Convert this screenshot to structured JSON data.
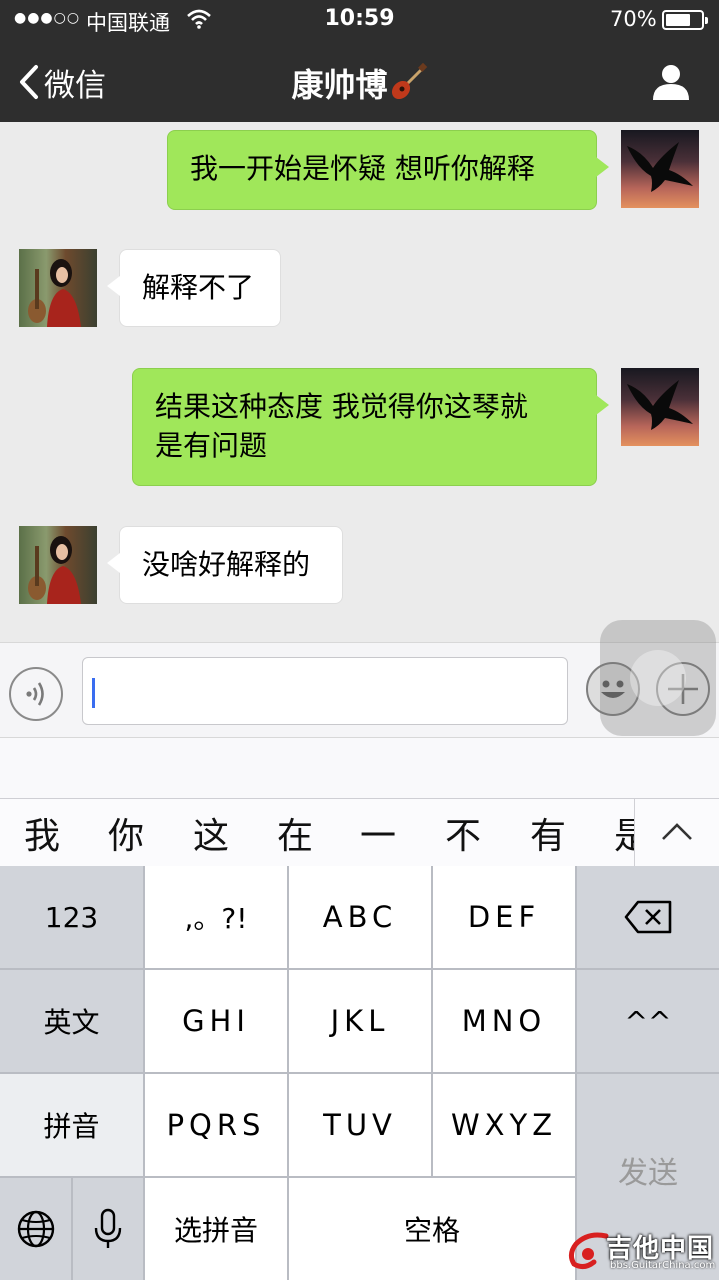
{
  "status_bar": {
    "signal": "●●●○○",
    "carrier": "中国联通",
    "time": "10:59",
    "battery_percent": "70%",
    "battery_level": 0.7
  },
  "nav": {
    "back_label": "微信",
    "title": "康帅博",
    "title_icon": "guitar-icon",
    "profile_icon": "person-icon"
  },
  "messages": [
    {
      "side": "sent",
      "text": "我一开始是怀疑 想听你解释",
      "avatar": "eagle-avatar"
    },
    {
      "side": "received",
      "text": "解释不了",
      "avatar": "girl-with-guitar-avatar"
    },
    {
      "side": "sent",
      "line1": "结果这种态度 我觉得你这琴就",
      "line2": "是有问题",
      "avatar": "eagle-avatar"
    },
    {
      "side": "received",
      "text": "没啥好解释的",
      "avatar": "girl-with-guitar-avatar"
    }
  ],
  "input": {
    "value": "",
    "voice_icon": "voice-icon",
    "emoji_icon": "smiley-icon",
    "plus_icon": "plus-icon"
  },
  "candidates": [
    "我",
    "你",
    "这",
    "在",
    "一",
    "不",
    "有",
    "是"
  ],
  "keyboard": {
    "row1": [
      "123",
      ",。?!",
      "ABC",
      "DEF"
    ],
    "row2": [
      "英文",
      "GHI",
      "JKL",
      "MNO",
      "^^"
    ],
    "row3": [
      "拼音",
      "PQRS",
      "TUV",
      "WXYZ"
    ],
    "select_pinyin": "选拼音",
    "space": "空格",
    "send": "发送",
    "delete_icon": "backspace-icon",
    "globe_icon": "globe-icon",
    "mic_icon": "microphone-icon"
  },
  "watermark": {
    "main": "吉他中国",
    "sub": "bbs.GuitarChina.com"
  },
  "colors": {
    "nav_bg": "#2e2e2e",
    "sent_bubble": "#a0e75a",
    "received_bubble": "#ffffff",
    "chat_bg": "#ebebeb",
    "caret": "#3a6df0"
  }
}
